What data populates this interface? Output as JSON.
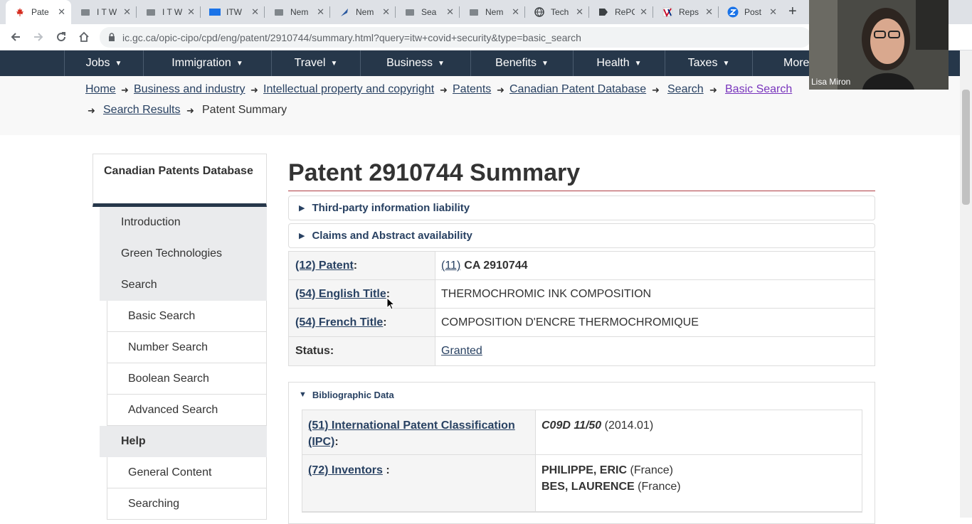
{
  "browser": {
    "tabs": [
      {
        "label": "Pate",
        "active": true
      },
      {
        "label": "I T W"
      },
      {
        "label": "I T W"
      },
      {
        "label": "ITW"
      },
      {
        "label": "Nem"
      },
      {
        "label": "Nem"
      },
      {
        "label": "Sea"
      },
      {
        "label": "Nem"
      },
      {
        "label": "Tech"
      },
      {
        "label": "RePC"
      },
      {
        "label": "Reps"
      },
      {
        "label": "Post"
      }
    ],
    "url": "ic.gc.ca/opic-cipo/cpd/eng/patent/2910744/summary.html?query=itw+covid+security&type=basic_search"
  },
  "site_nav": [
    "Jobs",
    "Immigration",
    "Travel",
    "Business",
    "Benefits",
    "Health",
    "Taxes",
    "More"
  ],
  "breadcrumbs": {
    "home": "Home",
    "business": "Business and industry",
    "ip": "Intellectual property and copyright",
    "patents": "Patents",
    "cpd": "Canadian Patent Database",
    "search": "Search",
    "basic": "Basic Search",
    "results": "Search Results",
    "current": "Patent Summary"
  },
  "sidebar": {
    "heading": "Canadian Patents Database",
    "items": [
      "Introduction",
      "Green Technologies",
      "Search",
      "Basic Search",
      "Number Search",
      "Boolean Search",
      "Advanced Search",
      "Help",
      "General Content",
      "Searching"
    ]
  },
  "main": {
    "title": "Patent 2910744 Summary",
    "details1": "Third-party information liability",
    "details2": "Claims and Abstract availability",
    "rows": {
      "patent_label": "(12) Patent",
      "patent_num_label": "(11)",
      "patent_num": "CA 2910744",
      "en_title_label": "(54) English Title",
      "en_title": "THERMOCHROMIC INK COMPOSITION",
      "fr_title_label": "(54) French Title",
      "fr_title": "COMPOSITION D'ENCRE THERMOCHROMIQUE",
      "status_label": "Status:",
      "status": "Granted"
    },
    "biblio": {
      "heading": "Bibliographic Data",
      "ipc_label": "(51) International Patent Classification (IPC)",
      "ipc_code": "C09D 11/50",
      "ipc_date": "(2014.01)",
      "inventors_label": "(72) Inventors",
      "inv1_name": "PHILIPPE, ERIC",
      "inv1_country": "(France)",
      "inv2_name": "BES, LAURENCE",
      "inv2_country": "(France)"
    }
  },
  "video": {
    "name": "Lisa Miron"
  },
  "colors": {
    "nav_bg": "#26374a",
    "link": "#284162",
    "visited": "#7834bc",
    "rule": "#af3c43"
  }
}
